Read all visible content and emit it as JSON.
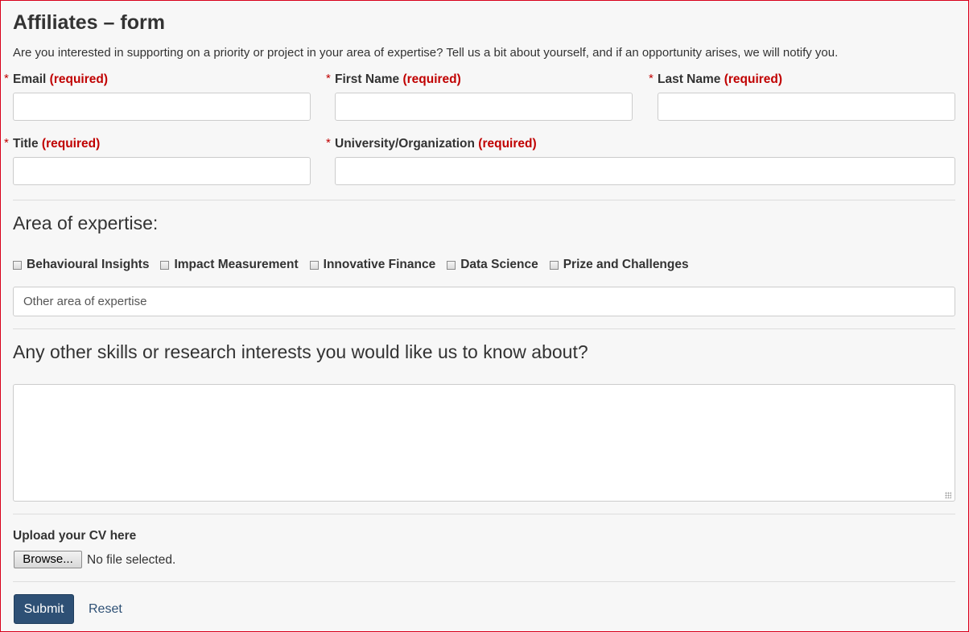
{
  "form": {
    "title": "Affiliates – form",
    "intro": "Are you interested in supporting on a priority or project in your area of expertise? Tell us a bit about yourself, and if an opportunity arises, we will notify you.",
    "required_marker": "*",
    "required_text": "(required)",
    "fields": {
      "email": {
        "label": "Email",
        "value": ""
      },
      "first_name": {
        "label": "First Name",
        "value": ""
      },
      "last_name": {
        "label": "Last Name",
        "value": ""
      },
      "title": {
        "label": "Title",
        "value": ""
      },
      "organization": {
        "label": "University/Organization",
        "value": ""
      }
    },
    "expertise": {
      "heading": "Area of expertise:",
      "options": [
        {
          "label": "Behavioural Insights",
          "checked": false
        },
        {
          "label": "Impact Measurement",
          "checked": false
        },
        {
          "label": "Innovative Finance",
          "checked": false
        },
        {
          "label": "Data Science",
          "checked": false
        },
        {
          "label": "Prize and Challenges",
          "checked": false
        }
      ],
      "other_placeholder": "Other area of expertise"
    },
    "skills": {
      "heading": "Any other skills or research interests you would like us to know about?",
      "value": ""
    },
    "upload": {
      "label": "Upload your CV here",
      "browse_label": "Browse...",
      "status": "No file selected."
    },
    "actions": {
      "submit_label": "Submit",
      "reset_label": "Reset"
    }
  },
  "colors": {
    "frame_border": "#d9001b",
    "required": "#c00000",
    "primary_button": "#2e5075",
    "background": "#f7f7f7"
  }
}
